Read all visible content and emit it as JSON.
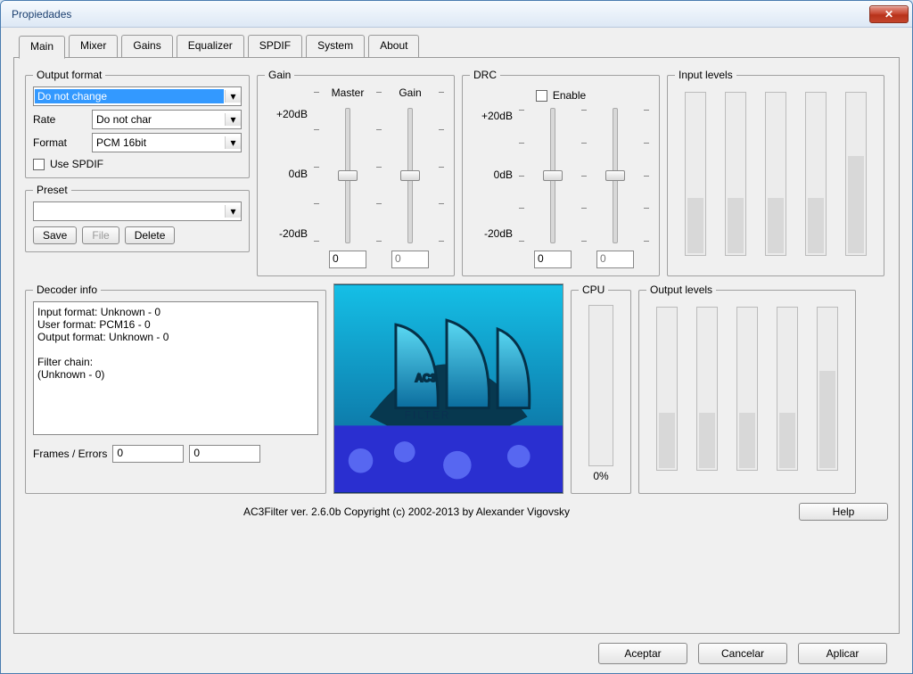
{
  "window": {
    "title": "Propiedades"
  },
  "tabs": [
    "Main",
    "Mixer",
    "Gains",
    "Equalizer",
    "SPDIF",
    "System",
    "About"
  ],
  "active_tab": 0,
  "output_format": {
    "legend": "Output format",
    "speakers": "Do not change",
    "rate_label": "Rate",
    "rate": "Do not char",
    "format_label": "Format",
    "format": "PCM 16bit",
    "use_spdif_label": "Use SPDIF"
  },
  "preset": {
    "legend": "Preset",
    "value": "",
    "save": "Save",
    "file": "File",
    "delete": "Delete"
  },
  "gain": {
    "legend": "Gain",
    "col1": "Master",
    "col2": "Gain",
    "ticks": [
      "+20dB",
      "0dB",
      "-20dB"
    ],
    "v1": "0",
    "v2": "0"
  },
  "drc": {
    "legend": "DRC",
    "enable": "Enable",
    "ticks": [
      "+20dB",
      "0dB",
      "-20dB"
    ],
    "v1": "0",
    "v2": "0"
  },
  "input_levels": {
    "legend": "Input levels"
  },
  "output_levels": {
    "legend": "Output levels"
  },
  "cpu": {
    "legend": "CPU",
    "value": "0%"
  },
  "decoder": {
    "legend": "Decoder info",
    "text": "Input format: Unknown - 0\nUser format: PCM16 - 0\nOutput format: Unknown - 0\n\nFilter chain:\n(Unknown - 0)",
    "frames_label": "Frames / Errors",
    "frames": "0",
    "errors": "0"
  },
  "logo_text": "AC3 FILTER",
  "copyright": "AC3Filter ver. 2.6.0b Copyright (c) 2002-2013 by Alexander Vigovsky",
  "help": "Help",
  "buttons": {
    "ok": "Aceptar",
    "cancel": "Cancelar",
    "apply": "Aplicar"
  }
}
